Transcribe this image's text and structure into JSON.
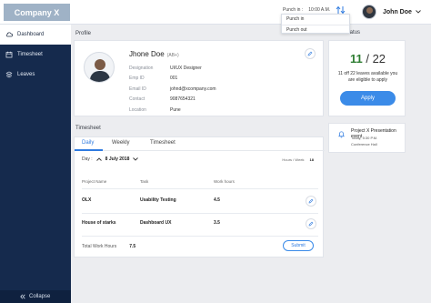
{
  "header": {
    "logo": "Company X",
    "punch_label": "Punch in :",
    "punch_time": "10:00 A.M.",
    "punch_options": [
      "Punch in",
      "Punch out"
    ],
    "user_name": "John Doe"
  },
  "sidebar": {
    "items": [
      {
        "label": "Dashboard",
        "icon": "cloud-icon",
        "active": true
      },
      {
        "label": "Timesheet",
        "icon": "calendar-icon",
        "active": false
      },
      {
        "label": "Leaves",
        "icon": "leaves-icon",
        "active": false
      }
    ],
    "collapse_label": "Collapse"
  },
  "profile": {
    "section_title": "Profile",
    "name": "Jhone Doe",
    "blood_group": "(AB+)",
    "fields": [
      {
        "label": "Designation",
        "value": "UI/UX Designer"
      },
      {
        "label": "Emp ID",
        "value": "001"
      },
      {
        "label": "Email ID",
        "value": "johnd@xcompany.com"
      },
      {
        "label": "Contact",
        "value": "9087654321"
      },
      {
        "label": "Location",
        "value": "Pune"
      }
    ]
  },
  "leave": {
    "section_title": "Leave Status",
    "available": "11",
    "total": "22",
    "text": "11 off 22 leaves available you are eligible to apply",
    "apply_label": "Apply"
  },
  "event": {
    "title": "Project X Presentation event",
    "time": "Today, 5:30 P.M.",
    "place": "Conference Hall"
  },
  "timesheet": {
    "section_title": "Timesheet",
    "tabs": [
      "Daily",
      "Weekly",
      "Timesheet"
    ],
    "day_label": "Day :",
    "date": "8 July 2018",
    "hours_label": "Hours / Week",
    "hours_value": "18",
    "columns": [
      "Project Name",
      "Task",
      "Work hours"
    ],
    "rows": [
      {
        "project": "OLX",
        "task": "Usability Testing",
        "hours": "4.5"
      },
      {
        "project": "House of starks",
        "task": "Dashboard UX",
        "hours": "3.5"
      }
    ],
    "total_label": "Total Work Hours",
    "total_value": "7.5",
    "submit_label": "Submit"
  },
  "colors": {
    "sidebar": "#152a4d",
    "accent": "#3b8be8",
    "available": "#2e7d32"
  }
}
